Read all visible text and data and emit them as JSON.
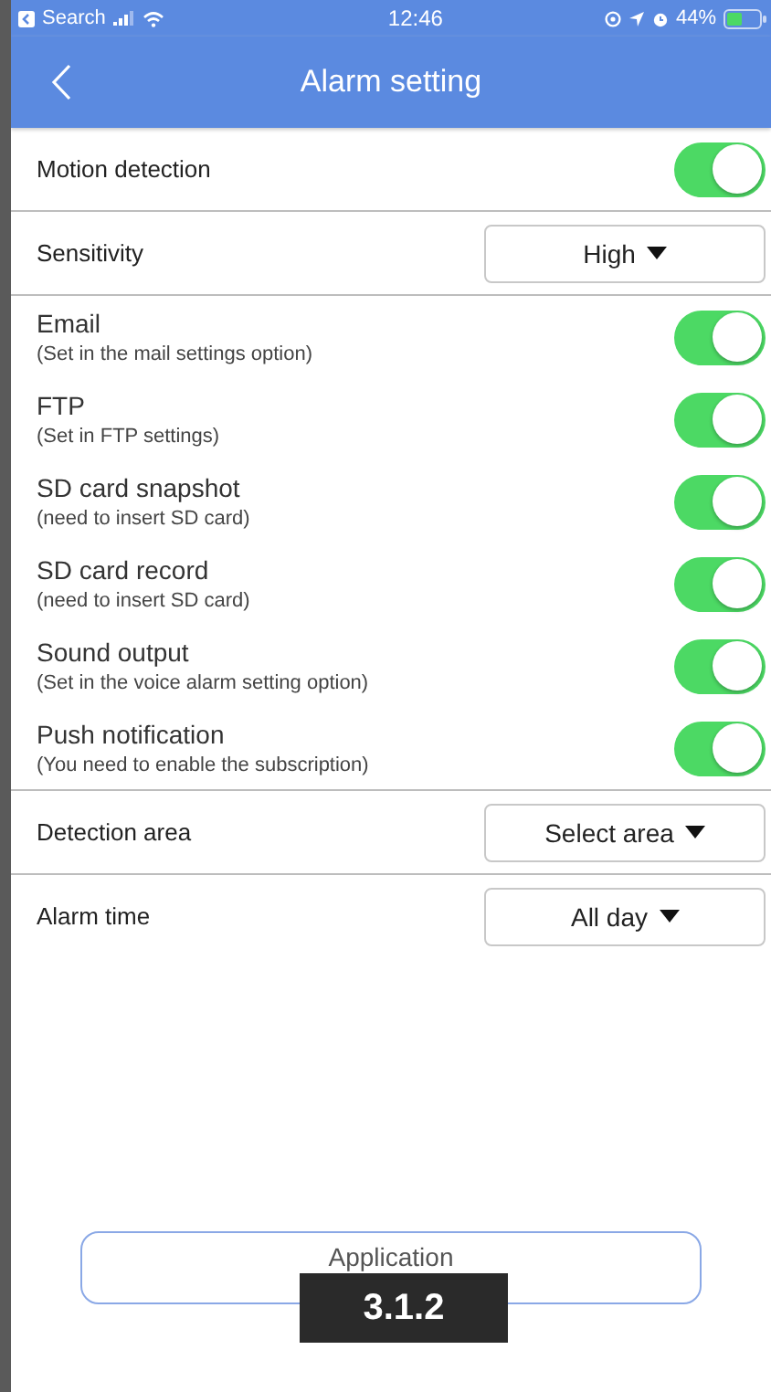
{
  "status_bar": {
    "back_app": "Search",
    "time": "12:46",
    "battery": "44%"
  },
  "nav_bar": {
    "title": "Alarm setting"
  },
  "settings": [
    {
      "kind": "toggle",
      "label": "Motion detection",
      "on": true,
      "divider": true
    },
    {
      "kind": "dropdown",
      "label": "Sensitivity",
      "value": "High",
      "divider": true
    },
    {
      "kind": "toggle",
      "label": "Email",
      "hint": "(Set in the mail settings option)",
      "on": true
    },
    {
      "kind": "toggle",
      "label": "FTP",
      "hint": "(Set in FTP settings)",
      "on": true
    },
    {
      "kind": "toggle",
      "label": "SD card snapshot",
      "hint": "(need to insert SD card)",
      "on": true
    },
    {
      "kind": "toggle",
      "label": "SD card record",
      "hint": "(need to insert SD card)",
      "on": true
    },
    {
      "kind": "toggle",
      "label": "Sound output",
      "hint": "(Set in the voice alarm setting option)",
      "on": true
    },
    {
      "kind": "toggle",
      "label": "Push notification",
      "hint": "(You need to enable the subscription)",
      "on": true,
      "divider": true
    },
    {
      "kind": "dropdown",
      "label": "Detection area",
      "value": "Select area",
      "divider": true
    },
    {
      "kind": "dropdown",
      "label": "Alarm time",
      "value": "All day"
    }
  ],
  "apply_button": {
    "label": "Application"
  },
  "figure_label": "3.1.2"
}
